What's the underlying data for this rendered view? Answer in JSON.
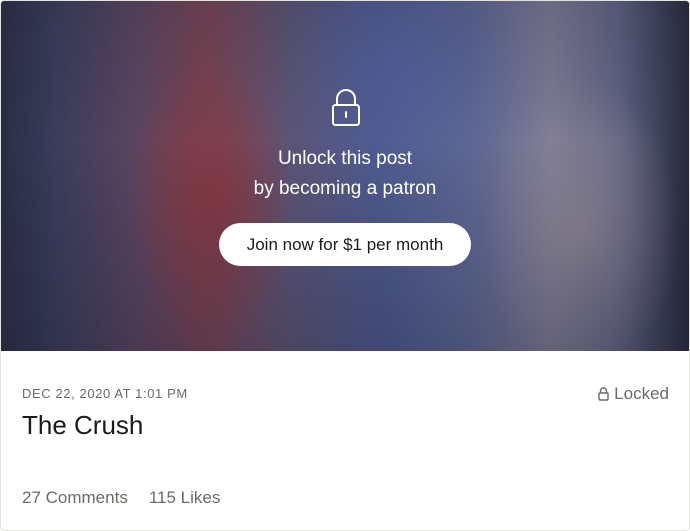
{
  "hero": {
    "lock_icon": "lock-icon",
    "unlock_line1": "Unlock this post",
    "unlock_line2": "by becoming a patron",
    "join_button": "Join now for $1 per month"
  },
  "post": {
    "date": "DEC 22, 2020 AT 1:01 PM",
    "locked_icon": "lock-icon",
    "locked_label": "Locked",
    "title": "The Crush",
    "comments": "27 Comments",
    "likes": "115 Likes"
  }
}
